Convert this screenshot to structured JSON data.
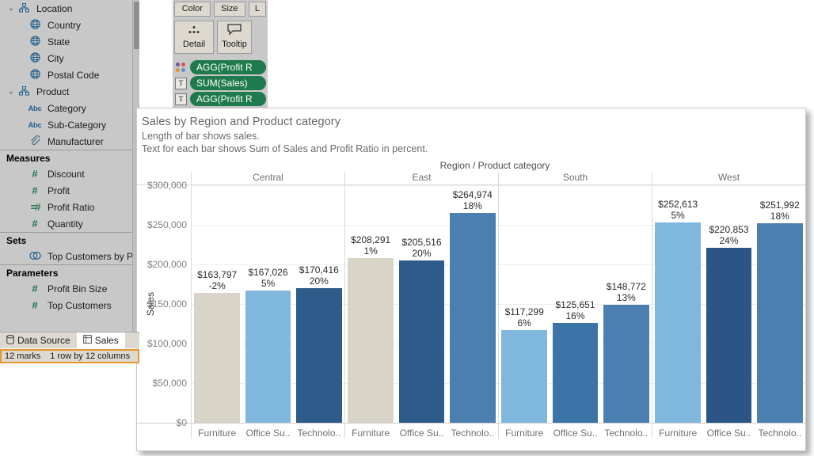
{
  "sidebar": {
    "items": [
      {
        "label": "Location",
        "icon": "hierarchy-icon",
        "type": "group",
        "caret": "⌄"
      },
      {
        "label": "Country",
        "icon": "globe-icon",
        "type": "child"
      },
      {
        "label": "State",
        "icon": "globe-icon",
        "type": "child"
      },
      {
        "label": "City",
        "icon": "globe-icon",
        "type": "child"
      },
      {
        "label": "Postal Code",
        "icon": "globe-icon",
        "type": "child"
      },
      {
        "label": "Product",
        "icon": "hierarchy-icon",
        "type": "group",
        "caret": "⌄"
      },
      {
        "label": "Category",
        "icon": "abc-icon",
        "type": "child"
      },
      {
        "label": "Sub-Category",
        "icon": "abc-icon",
        "type": "child"
      },
      {
        "label": "Manufacturer",
        "icon": "paperclip-icon",
        "type": "child"
      }
    ],
    "sections": [
      {
        "header": "Measures",
        "items": [
          {
            "label": "Discount",
            "icon": "number-icon"
          },
          {
            "label": "Profit",
            "icon": "number-icon"
          },
          {
            "label": "Profit Ratio",
            "icon": "calculated-number-icon"
          },
          {
            "label": "Quantity",
            "icon": "number-icon"
          }
        ]
      },
      {
        "header": "Sets",
        "items": [
          {
            "label": "Top Customers by Prof",
            "icon": "set-icon"
          }
        ]
      },
      {
        "header": "Parameters",
        "items": [
          {
            "label": "Profit Bin Size",
            "icon": "number-icon"
          },
          {
            "label": "Top Customers",
            "icon": "number-icon"
          }
        ]
      }
    ]
  },
  "marks_card": {
    "buttons_top": [
      {
        "label": "Color",
        "icon": "color-icon"
      },
      {
        "label": "Size",
        "icon": "size-icon"
      },
      {
        "label": "L",
        "icon": "label-icon"
      }
    ],
    "buttons_bottom": [
      {
        "label": "Detail",
        "icon": "detail-icon",
        "glyph": "⁙"
      },
      {
        "label": "Tooltip",
        "icon": "tooltip-icon",
        "glyph": "⬚"
      }
    ],
    "pills": [
      {
        "label": "AGG(Profit R",
        "icon": "color-swatch-icon",
        "icon_char": ""
      },
      {
        "label": "SUM(Sales)",
        "icon": "text-icon",
        "icon_char": "T"
      },
      {
        "label": "AGG(Profit R",
        "icon": "text-icon",
        "icon_char": "T"
      }
    ],
    "pill_color": "#1f7a4d"
  },
  "chart_panel": {
    "title": "Sales by Region and Product category",
    "subtitle_1": "Length of bar shows sales.",
    "subtitle_2": "Text for each bar shows Sum of Sales and Profit Ratio in percent."
  },
  "bottom": {
    "tabs": [
      {
        "label": "Data Source",
        "icon": "database-icon",
        "active": false
      },
      {
        "label": "Sales",
        "icon": "sheet-icon",
        "active": true
      }
    ],
    "status_marks": "12 marks",
    "status_dims": "1 row by 12 columns",
    "status_highlight_color": "#e8962e"
  },
  "chart_data": {
    "type": "bar",
    "title": "Sales by Region and Product category",
    "subtitle": "Length of bar shows sales. Text for each bar shows Sum of Sales and Profit Ratio in percent.",
    "column_header": "Region / Product category",
    "xlabel": "Region / Product category",
    "ylabel": "Sales",
    "ylim": [
      0,
      300000
    ],
    "ytick_labels": [
      "$300,000",
      "$250,000",
      "$200,000",
      "$150,000",
      "$100,000",
      "$50,000",
      "$0"
    ],
    "ytick_values": [
      300000,
      250000,
      200000,
      150000,
      100000,
      50000,
      0
    ],
    "grid": true,
    "legend": "none",
    "categories": [
      "Furniture",
      "Office Su..",
      "Technolo.."
    ],
    "groups": [
      {
        "name": "Central",
        "bars": [
          {
            "category": "Furniture",
            "value": 163797,
            "value_label": "$163,797",
            "profit_ratio": -2,
            "ratio_label": "-2%",
            "color": "#d8d4c7"
          },
          {
            "category": "Office Su..",
            "value": 167026,
            "value_label": "$167,026",
            "profit_ratio": 5,
            "ratio_label": "5%",
            "color": "#80b8dd"
          },
          {
            "category": "Technolo..",
            "value": 170416,
            "value_label": "$170,416",
            "profit_ratio": 20,
            "ratio_label": "20%",
            "color": "#2d5c8a"
          }
        ]
      },
      {
        "name": "East",
        "bars": [
          {
            "category": "Furniture",
            "value": 208291,
            "value_label": "$208,291",
            "profit_ratio": 1,
            "ratio_label": "1%",
            "color": "#d8d4c7"
          },
          {
            "category": "Office Su..",
            "value": 205516,
            "value_label": "$205,516",
            "profit_ratio": 20,
            "ratio_label": "20%",
            "color": "#2d5c8a"
          },
          {
            "category": "Technolo..",
            "value": 264974,
            "value_label": "$264,974",
            "profit_ratio": 18,
            "ratio_label": "18%",
            "color": "#4a7fb0"
          }
        ]
      },
      {
        "name": "South",
        "bars": [
          {
            "category": "Furniture",
            "value": 117299,
            "value_label": "$117,299",
            "profit_ratio": 6,
            "ratio_label": "6%",
            "color": "#80b8dd"
          },
          {
            "category": "Office Su..",
            "value": 125651,
            "value_label": "$125,651",
            "profit_ratio": 16,
            "ratio_label": "16%",
            "color": "#3d74a8"
          },
          {
            "category": "Technolo..",
            "value": 148772,
            "value_label": "$148,772",
            "profit_ratio": 13,
            "ratio_label": "13%",
            "color": "#4a7fb0"
          }
        ]
      },
      {
        "name": "West",
        "bars": [
          {
            "category": "Furniture",
            "value": 252613,
            "value_label": "$252,613",
            "profit_ratio": 5,
            "ratio_label": "5%",
            "color": "#80b8dd"
          },
          {
            "category": "Office Su..",
            "value": 220853,
            "value_label": "$220,853",
            "profit_ratio": 24,
            "ratio_label": "24%",
            "color": "#2a5584"
          },
          {
            "category": "Technolo..",
            "value": 251992,
            "value_label": "$251,992",
            "profit_ratio": 18,
            "ratio_label": "18%",
            "color": "#4a7fb0"
          }
        ]
      }
    ]
  }
}
